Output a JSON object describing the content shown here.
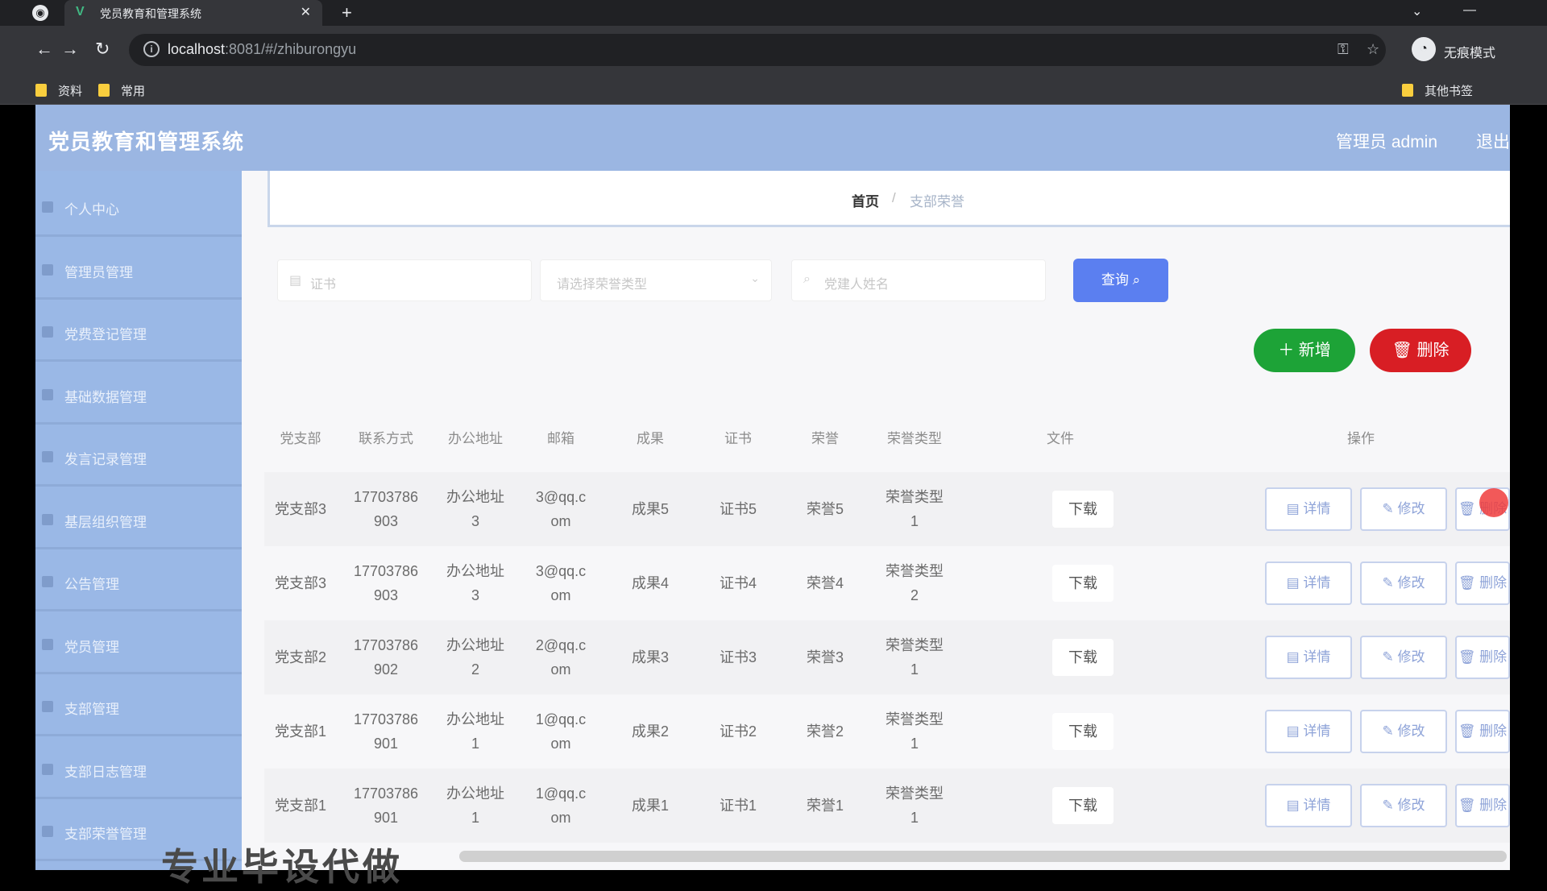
{
  "browser": {
    "tab_title": "党员教育和管理系统",
    "url_host": "localhost",
    "url_rest": ":8081/#/zhiburongyu",
    "incognito_label": "无痕模式",
    "bookmarks": [
      "资料",
      "常用"
    ],
    "other_bookmarks": "其他书签"
  },
  "app": {
    "title": "党员教育和管理系统",
    "admin_label": "管理员 admin",
    "logout": "退出"
  },
  "sidebar": {
    "items": [
      {
        "label": "个人中心"
      },
      {
        "label": "管理员管理"
      },
      {
        "label": "党费登记管理"
      },
      {
        "label": "基础数据管理"
      },
      {
        "label": "发言记录管理"
      },
      {
        "label": "基层组织管理"
      },
      {
        "label": "公告管理"
      },
      {
        "label": "党员管理"
      },
      {
        "label": "支部管理"
      },
      {
        "label": "支部日志管理"
      },
      {
        "label": "支部荣誉管理"
      }
    ]
  },
  "breadcrumb": {
    "home": "首页",
    "current": "支部荣誉"
  },
  "search": {
    "field1_placeholder": "证书",
    "field2_placeholder": "请选择荣誉类型",
    "field3_placeholder": "党建人姓名",
    "query_label": "查询"
  },
  "actions": {
    "add_label": "新增",
    "delete_label": "删除"
  },
  "table": {
    "headers": [
      "党支部",
      "联系方式",
      "办公地址",
      "邮箱",
      "成果",
      "证书",
      "荣誉",
      "荣誉类型",
      "文件",
      "操作"
    ],
    "download_label": "下载",
    "detail_label": "详情",
    "edit_label": "修改",
    "delete_label": "删除",
    "rows": [
      {
        "branch": "党支部3",
        "phone": "17703786903",
        "address": "办公地址3",
        "email": "3@qq.com",
        "result": "成果5",
        "cert": "证书5",
        "honor": "荣誉5",
        "honor_type": "荣誉类型1"
      },
      {
        "branch": "党支部3",
        "phone": "17703786903",
        "address": "办公地址3",
        "email": "3@qq.com",
        "result": "成果4",
        "cert": "证书4",
        "honor": "荣誉4",
        "honor_type": "荣誉类型2"
      },
      {
        "branch": "党支部2",
        "phone": "17703786902",
        "address": "办公地址2",
        "email": "2@qq.com",
        "result": "成果3",
        "cert": "证书3",
        "honor": "荣誉3",
        "honor_type": "荣誉类型1"
      },
      {
        "branch": "党支部1",
        "phone": "17703786901",
        "address": "办公地址1",
        "email": "1@qq.com",
        "result": "成果2",
        "cert": "证书2",
        "honor": "荣誉2",
        "honor_type": "荣誉类型1"
      },
      {
        "branch": "党支部1",
        "phone": "17703786901",
        "address": "办公地址1",
        "email": "1@qq.com",
        "result": "成果1",
        "cert": "证书1",
        "honor": "荣誉1",
        "honor_type": "荣誉类型1"
      }
    ]
  },
  "overlay_text": "专业毕设代做"
}
